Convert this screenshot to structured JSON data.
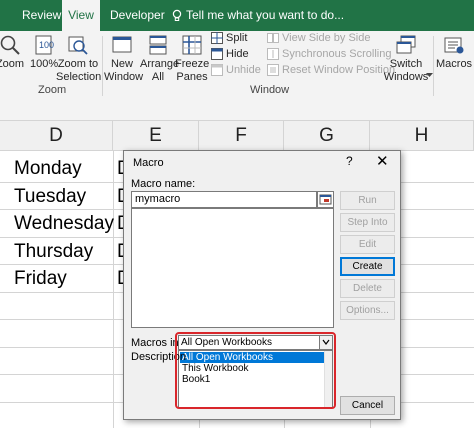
{
  "ribbon": {
    "tabs": [
      "Review",
      "View",
      "Developer"
    ],
    "active_tab": "View",
    "tell_me": "Tell me what you want to do...",
    "buttons": {
      "zoom": "Zoom",
      "zoom100": "100%",
      "zoom_selection": [
        "Zoom to",
        "Selection"
      ],
      "new_window": [
        "New",
        "Window"
      ],
      "arrange_all": [
        "Arrange",
        "All"
      ],
      "freeze_panes": [
        "Freeze",
        "Panes"
      ],
      "split": "Split",
      "hide": "Hide",
      "unhide": "Unhide",
      "view_side_by_side": "View Side by Side",
      "sync_scrolling": "Synchronous Scrolling",
      "reset_window_position": "Reset Window Position",
      "switch_windows": [
        "Switch",
        "Windows"
      ],
      "macros": "Macros"
    },
    "groups": {
      "zoom": "Zoom",
      "window": "Window"
    }
  },
  "sheet": {
    "columns": [
      "D",
      "E",
      "F",
      "G",
      "H"
    ],
    "cells_d": [
      "Monday",
      "Tuesday",
      "Wednesday",
      "Thursday",
      "Friday"
    ],
    "cells_e": [
      "D",
      "D",
      "D",
      "D",
      "D"
    ]
  },
  "dialog": {
    "title": "Macro",
    "help": "?",
    "close": "✕",
    "macro_name_label": "Macro name:",
    "macro_name_value": "mymacro",
    "buttons": [
      "Run",
      "Step Into",
      "Edit",
      "Create",
      "Delete",
      "Options..."
    ],
    "macros_in_label": "Macros in:",
    "macros_in_value": "All Open Workbooks",
    "macros_in_options": [
      "All Open Workbooks",
      "This Workbook",
      "Book1"
    ],
    "description_label": "Description",
    "cancel": "Cancel"
  },
  "colors": {
    "excel_green": "#217346",
    "highlight_red": "#d9262b",
    "selection_blue": "#0078d7"
  }
}
